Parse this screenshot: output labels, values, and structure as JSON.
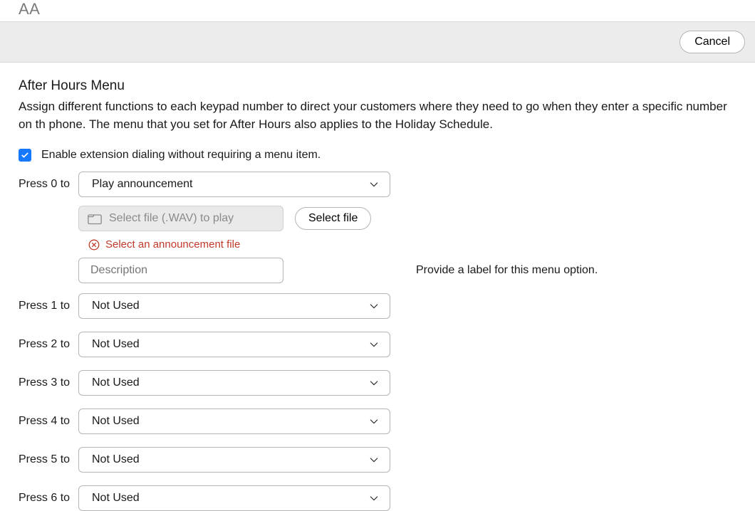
{
  "top_label": "AA",
  "toolbar": {
    "cancel_label": "Cancel"
  },
  "section": {
    "title": "After Hours Menu",
    "description": "Assign different functions to each keypad number to direct your customers where they need to go when they enter a specific number on th phone. The menu that you set for After Hours also applies to the Holiday Schedule."
  },
  "enable": {
    "checked": true,
    "label": "Enable extension dialing without requiring a menu item."
  },
  "press0": {
    "label": "Press 0 to",
    "select_value": "Play announcement",
    "file_placeholder": "Select file (.WAV) to play",
    "select_file_btn": "Select file",
    "error_text": "Select an announcement file",
    "description_placeholder": "Description",
    "hint": "Provide a label for this menu option."
  },
  "rows": [
    {
      "label": "Press 1 to",
      "value": "Not Used"
    },
    {
      "label": "Press 2 to",
      "value": "Not Used"
    },
    {
      "label": "Press 3 to",
      "value": "Not Used"
    },
    {
      "label": "Press 4 to",
      "value": "Not Used"
    },
    {
      "label": "Press 5 to",
      "value": "Not Used"
    },
    {
      "label": "Press 6 to",
      "value": "Not Used"
    }
  ]
}
